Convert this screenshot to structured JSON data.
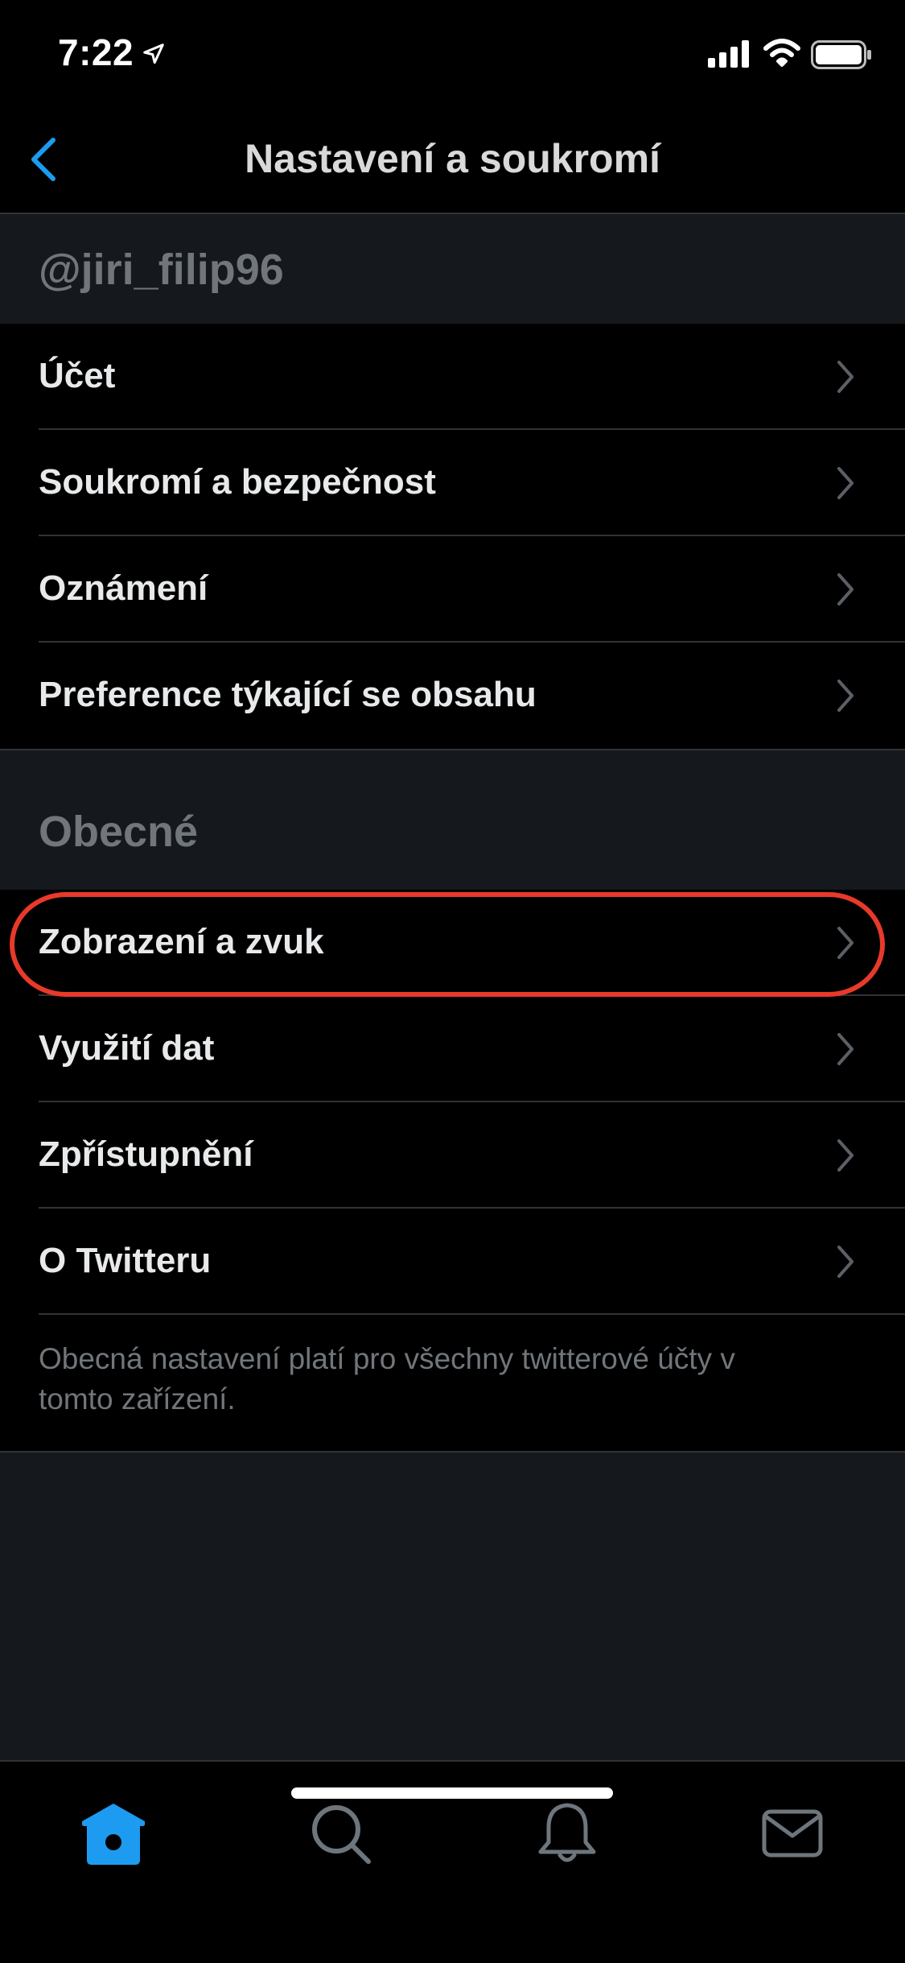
{
  "status": {
    "time": "7:22",
    "icons": [
      "location-arrow-icon",
      "signal-icon",
      "wifi-icon",
      "battery-icon"
    ]
  },
  "nav": {
    "title": "Nastavení a soukromí",
    "back_icon": "chevron-left-icon"
  },
  "account_section": {
    "header": "@jiri_filip96",
    "items": [
      {
        "label": "Účet"
      },
      {
        "label": "Soukromí a bezpečnost"
      },
      {
        "label": "Oznámení"
      },
      {
        "label": "Preference týkající se obsahu"
      }
    ]
  },
  "general_section": {
    "header": "Obecné",
    "items": [
      {
        "label": "Zobrazení a zvuk"
      },
      {
        "label": "Využití dat"
      },
      {
        "label": "Zpřístupnění"
      },
      {
        "label": "O Twitteru"
      }
    ],
    "note": "Obecná nastavení platí pro všechny twitterové účty v tomto zařízení."
  },
  "tabs": [
    {
      "icon": "home-icon",
      "active": true
    },
    {
      "icon": "search-icon",
      "active": false
    },
    {
      "icon": "bell-icon",
      "active": false
    },
    {
      "icon": "mail-icon",
      "active": false
    }
  ],
  "colors": {
    "accent": "#1d9bf0",
    "highlight": "#e8392a",
    "background": "#15181c"
  }
}
